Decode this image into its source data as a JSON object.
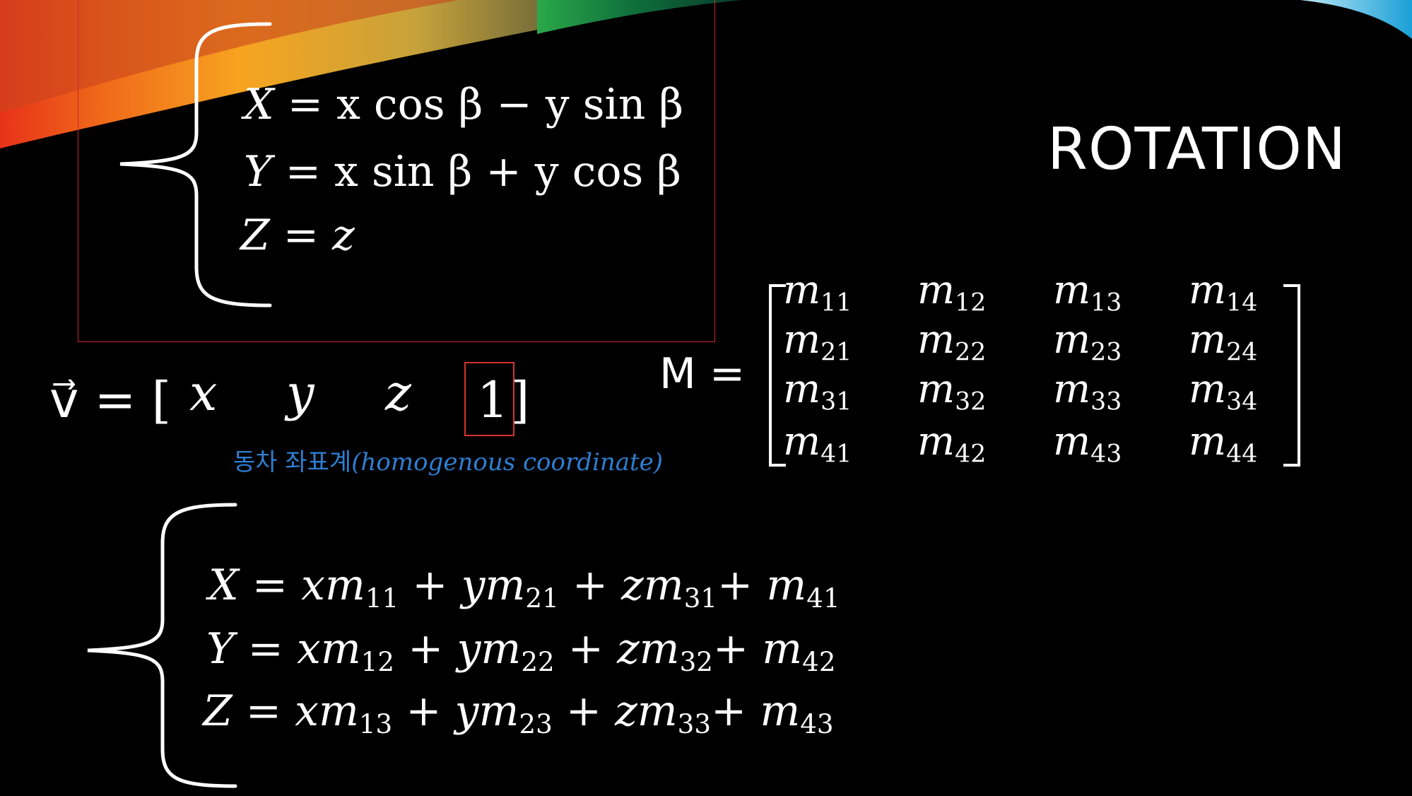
{
  "title": "ROTATION",
  "rotation_eqs": [
    {
      "lhs": "X",
      "rhs": "= x cos β − y sin β"
    },
    {
      "lhs": "Y",
      "rhs": "= x sin β + y cos β"
    },
    {
      "lhs": "Z",
      "rhs": "= z"
    }
  ],
  "vector": {
    "lhs": "v⃗ = [",
    "x": "x",
    "y": "y",
    "z": "z",
    "w": "1",
    "close": "]"
  },
  "homogenous_note": {
    "korean": "동차 좌표계",
    "english": "(homogenous coordinate)"
  },
  "matrix": {
    "label": "M =",
    "rows": [
      [
        "m11",
        "m12",
        "m13",
        "m14"
      ],
      [
        "m21",
        "m22",
        "m23",
        "m24"
      ],
      [
        "m31",
        "m32",
        "m33",
        "m34"
      ],
      [
        "m41",
        "m42",
        "m43",
        "m44"
      ]
    ]
  },
  "transform_eqs": [
    {
      "lhs": "X",
      "rhs": "xm11 + ym21 + zm31+ m41"
    },
    {
      "lhs": "Y",
      "rhs": "xm12 + ym22 + zm32+ m42"
    },
    {
      "lhs": "Z",
      "rhs": "xm13 + ym23 + zm33+ m43"
    }
  ],
  "colors": {
    "background": "#000000",
    "highlight_box": "#d4332c",
    "note": "#2e7fd2"
  }
}
